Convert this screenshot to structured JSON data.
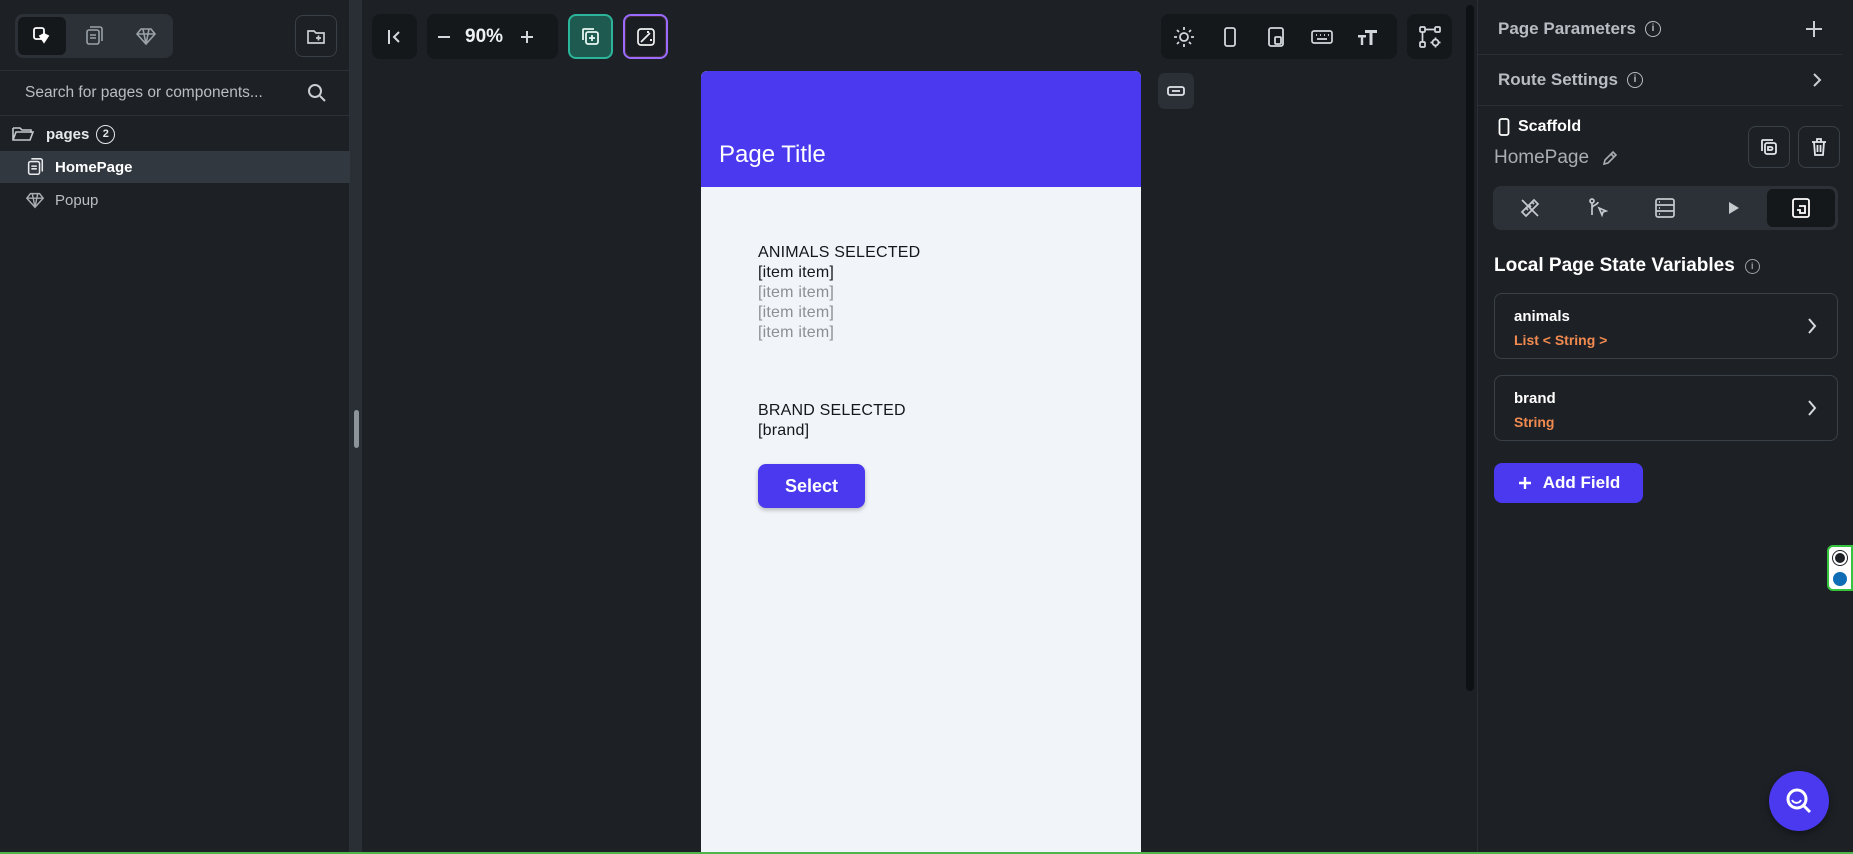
{
  "left_panel": {
    "search": {
      "placeholder": "Search for pages or components..."
    },
    "tree": {
      "folder_label": "pages",
      "folder_count": "2",
      "items": [
        {
          "label": "HomePage",
          "selected": true
        },
        {
          "label": "Popup",
          "selected": false
        }
      ]
    }
  },
  "toolbar": {
    "zoom": "90%"
  },
  "preview": {
    "app_bar_title": "Page Title",
    "animals_heading": "ANIMALS SELECTED",
    "animal_items": [
      "[item item]",
      "[item item]",
      "[item item]",
      "[item item]"
    ],
    "brand_heading": "BRAND SELECTED",
    "brand_value": "[brand]",
    "select_button": "Select",
    "colors": {
      "primary": "#4a39ef",
      "background": "#f1f4f8"
    }
  },
  "right_panel": {
    "page_parameters": "Page Parameters",
    "route_settings": "Route Settings",
    "widget_type": "Scaffold",
    "widget_name": "HomePage",
    "section_title": "Local Page State Variables",
    "variables": [
      {
        "name": "animals",
        "type": "List < String >"
      },
      {
        "name": "brand",
        "type": "String"
      }
    ],
    "add_field": "Add Field",
    "type_color": "#f28a50"
  }
}
